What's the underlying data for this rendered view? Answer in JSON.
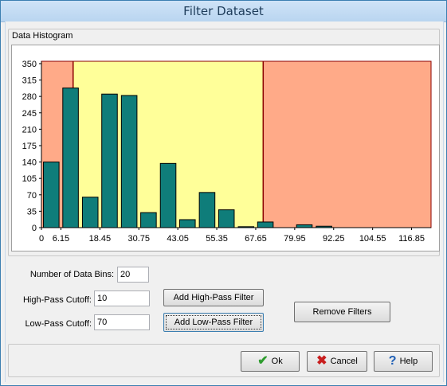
{
  "window": {
    "title": "Filter Dataset"
  },
  "histogram": {
    "group_label": "Data Histogram"
  },
  "chart_data": {
    "type": "bar",
    "x_ticks": [
      "0",
      "6.15",
      "18.45",
      "30.75",
      "43.05",
      "55.35",
      "67.65",
      "79.95",
      "92.25",
      "104.55",
      "116.85"
    ],
    "y_ticks": [
      "0",
      "35",
      "70",
      "105",
      "140",
      "175",
      "210",
      "245",
      "280",
      "315",
      "350"
    ],
    "ylim": [
      0,
      355
    ],
    "bins": [
      {
        "x": 3.1,
        "y": 140
      },
      {
        "x": 9.2,
        "y": 298
      },
      {
        "x": 15.4,
        "y": 65
      },
      {
        "x": 21.5,
        "y": 285
      },
      {
        "x": 27.7,
        "y": 282
      },
      {
        "x": 33.8,
        "y": 32
      },
      {
        "x": 40.0,
        "y": 137
      },
      {
        "x": 46.1,
        "y": 17
      },
      {
        "x": 52.3,
        "y": 75
      },
      {
        "x": 58.4,
        "y": 38
      },
      {
        "x": 64.6,
        "y": 2
      },
      {
        "x": 70.7,
        "y": 12
      },
      {
        "x": 76.9,
        "y": 0
      },
      {
        "x": 83.0,
        "y": 6
      },
      {
        "x": 89.2,
        "y": 3
      },
      {
        "x": 95.3,
        "y": 0
      },
      {
        "x": 101.5,
        "y": 0
      },
      {
        "x": 107.6,
        "y": 0
      },
      {
        "x": 113.8,
        "y": 0
      },
      {
        "x": 119.9,
        "y": 0
      }
    ],
    "high_pass_cutoff": 10,
    "low_pass_cutoff": 70,
    "colors": {
      "bar": "#0f7d7a",
      "pass_region": "#ffff99",
      "filtered_region": "#ffaa88",
      "cutoff_line": "#8b0000"
    }
  },
  "controls": {
    "num_bins_label": "Number of Data Bins:",
    "num_bins_value": "20",
    "high_pass_label": "High-Pass Cutoff:",
    "high_pass_value": "10",
    "low_pass_label": "Low-Pass Cutoff:",
    "low_pass_value": "70",
    "add_high_pass_button": "Add High-Pass Filter",
    "add_low_pass_button": "Add Low-Pass Filter",
    "remove_filters_button": "Remove Filters"
  },
  "footer": {
    "ok_button": "Ok",
    "cancel_button": "Cancel",
    "help_button": "Help",
    "ok_icon": "checkmark-icon",
    "cancel_icon": "x-icon",
    "help_icon": "question-icon"
  }
}
